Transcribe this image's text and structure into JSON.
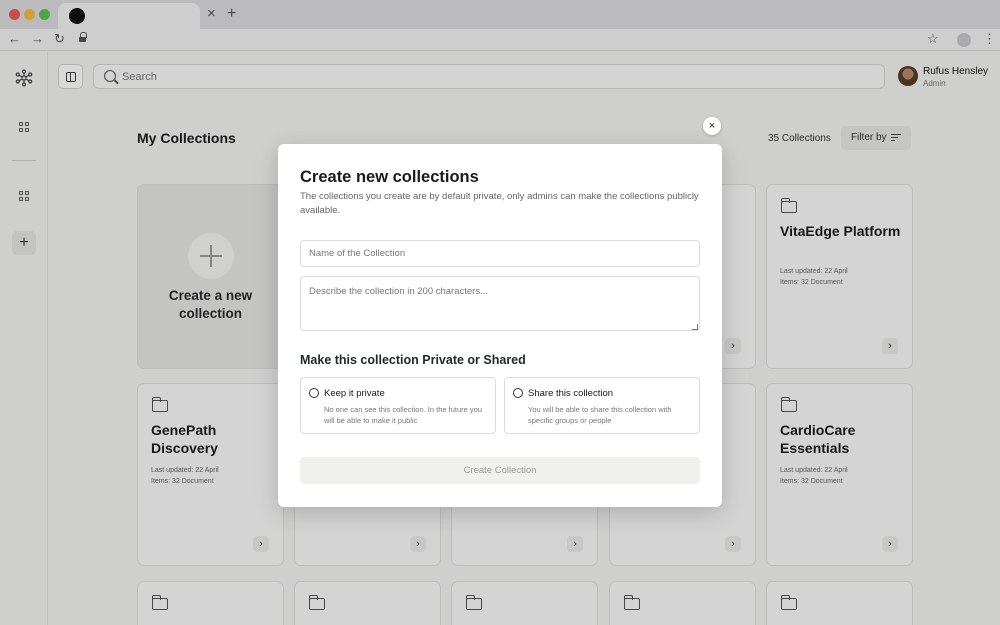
{
  "browser": {
    "tab_close": "×",
    "tab_new": "+",
    "nav_back": "←",
    "nav_forward": "→",
    "nav_reload": "↻",
    "bookmark": "☆",
    "menu": "⋮"
  },
  "header": {
    "search_placeholder": "Search",
    "user": {
      "name": "Rufus Hensley",
      "role": "Admin"
    }
  },
  "sidebar": {
    "add": "+"
  },
  "page": {
    "title": "My Collections",
    "count": "35 Collections",
    "filter_label": "Filter by"
  },
  "cards": {
    "create_label": "Create a new collection",
    "vitaedge": {
      "title": "VitaEdge Platform",
      "updated": "Last updated: 22 April",
      "items": "Items: 32 Document"
    },
    "genepath": {
      "title": "GenePath Discovery",
      "updated": "Last updated: 22 April",
      "items": "Items: 32 Document"
    },
    "cardiocare": {
      "title": "CardioCare Essentials",
      "updated": "Last updated: 22 April",
      "items": "Items: 32 Document"
    },
    "arrow": "›"
  },
  "modal": {
    "close": "×",
    "title": "Create new collections",
    "description": "The collections you create are by default private, only admins can make the collections publicly available.",
    "name_placeholder": "Name of the Collection",
    "desc_placeholder": "Describe the collection in 200 characters...",
    "section_title": "Make this collection Private or Shared",
    "private_label": "Keep it private",
    "private_desc": "No one can see this collection. In the future you will be able to make it public",
    "shared_label": "Share this collection",
    "shared_desc": "You will be able to share this collection with specific groups or people",
    "submit_label": "Create Collection"
  }
}
